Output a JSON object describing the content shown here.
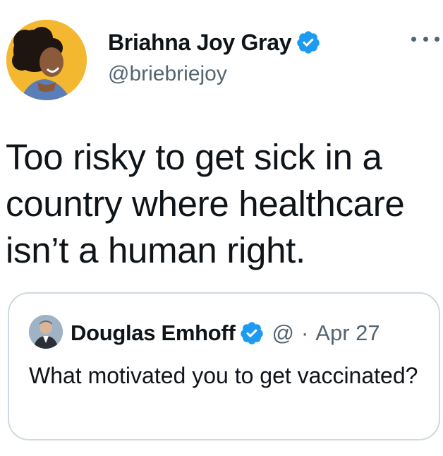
{
  "author": {
    "display_name": "Briahna Joy Gray",
    "handle": "@briebriejoy",
    "verified": true
  },
  "tweet": {
    "text": "Too risky to get sick in a country where healthcare isn’t a human right."
  },
  "quoted_tweet": {
    "display_name": "Douglas Emhoff",
    "verified": true,
    "handle_truncated": "@",
    "separator": "·",
    "date": "Apr 27",
    "text": "What motivated you to get vaccinated?"
  },
  "colors": {
    "verified_blue": "#1d9bf0",
    "secondary_text": "#536471",
    "border": "#cfd9de",
    "avatar_background": "#f4b830"
  },
  "icons": {
    "verified": "verified-badge-icon",
    "more": "more-horizontal-icon"
  }
}
